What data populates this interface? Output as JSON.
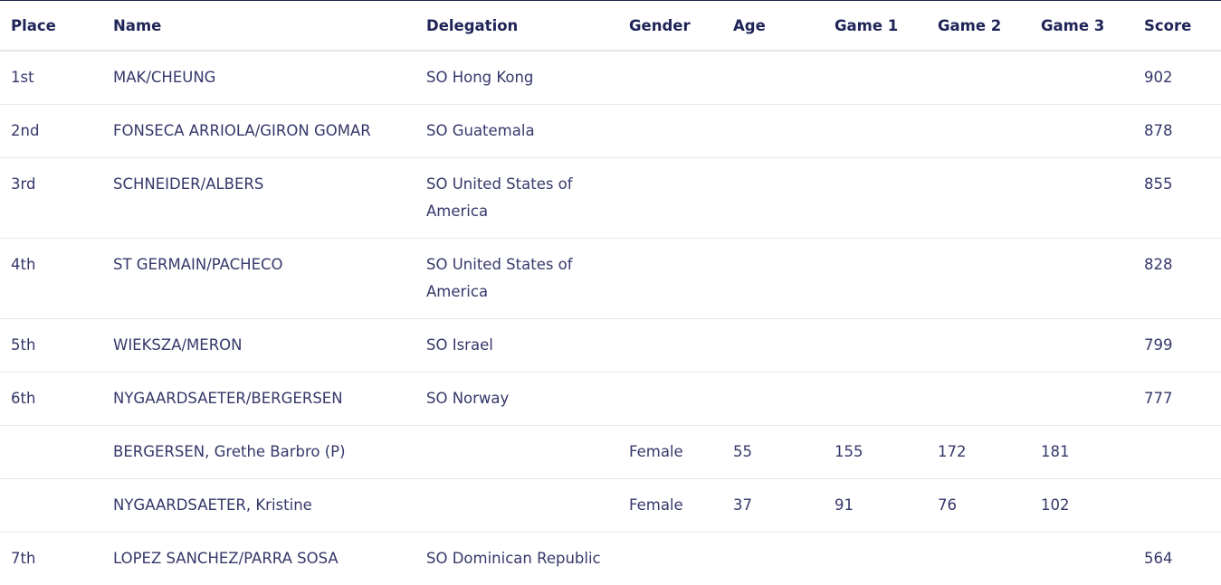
{
  "table": {
    "headers": {
      "place": "Place",
      "name": "Name",
      "delegation": "Delegation",
      "gender": "Gender",
      "age": "Age",
      "game1": "Game 1",
      "game2": "Game 2",
      "game3": "Game 3",
      "score": "Score"
    },
    "rows": [
      {
        "place": "1st",
        "name": "MAK/CHEUNG",
        "delegation": "SO Hong Kong",
        "gender": "",
        "age": "",
        "game1": "",
        "game2": "",
        "game3": "",
        "score": "902"
      },
      {
        "place": "2nd",
        "name": "FONSECA ARRIOLA/GIRON GOMAR",
        "delegation": "SO Guatemala",
        "gender": "",
        "age": "",
        "game1": "",
        "game2": "",
        "game3": "",
        "score": "878"
      },
      {
        "place": "3rd",
        "name": "SCHNEIDER/ALBERS",
        "delegation": "SO United States of America",
        "gender": "",
        "age": "",
        "game1": "",
        "game2": "",
        "game3": "",
        "score": "855"
      },
      {
        "place": "4th",
        "name": "ST GERMAIN/PACHECO",
        "delegation": "SO United States of America",
        "gender": "",
        "age": "",
        "game1": "",
        "game2": "",
        "game3": "",
        "score": "828"
      },
      {
        "place": "5th",
        "name": "WIEKSZA/MERON",
        "delegation": "SO Israel",
        "gender": "",
        "age": "",
        "game1": "",
        "game2": "",
        "game3": "",
        "score": "799"
      },
      {
        "place": "6th",
        "name": "NYGAARDSAETER/BERGERSEN",
        "delegation": "SO Norway",
        "gender": "",
        "age": "",
        "game1": "",
        "game2": "",
        "game3": "",
        "score": "777"
      },
      {
        "place": "",
        "name": "BERGERSEN, Grethe Barbro (P)",
        "delegation": "",
        "gender": "Female",
        "age": "55",
        "game1": "155",
        "game2": "172",
        "game3": "181",
        "score": ""
      },
      {
        "place": "",
        "name": "NYGAARDSAETER, Kristine",
        "delegation": "",
        "gender": "Female",
        "age": "37",
        "game1": "91",
        "game2": "76",
        "game3": "102",
        "score": ""
      },
      {
        "place": "7th",
        "name": "LOPEZ SANCHEZ/PARRA SOSA",
        "delegation": "SO Dominican Republic",
        "gender": "",
        "age": "",
        "game1": "",
        "game2": "",
        "game3": "",
        "score": "564"
      }
    ]
  }
}
